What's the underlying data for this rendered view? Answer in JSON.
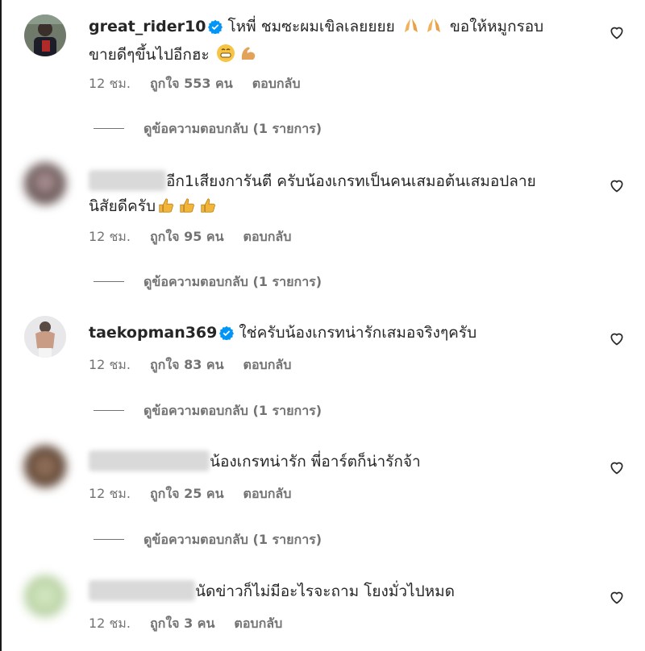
{
  "comments": [
    {
      "username": "great_rider10",
      "verified": true,
      "text": "โหพี่ ชมซะผมเขิลเลยยยย 🙏🙏 ขอให้หมูกรอบขายดีๆขึ้นไปอีกฮะ 😁💪",
      "text_line1": "โหพี่ ชมซะผมเขิลเลยยยย",
      "text_line1b": "ขอให้หมูกรอบ",
      "text_line2": "ขายดีๆขึ้นไปอีกฮะ",
      "time": "12 ชม.",
      "likes": "ถูกใจ 553 คน",
      "reply": "ตอบกลับ",
      "view_replies": "ดูข้อความตอบกลับ (1 รายการ)"
    },
    {
      "username": "",
      "verified": false,
      "text_line1": "อีก1เสียงการันตี ครับน้องเกรทเป็นคนเสมอต้นเสมอปลาย",
      "text_line2": "นิสัยดีครับ",
      "time": "12 ชม.",
      "likes": "ถูกใจ 95 คน",
      "reply": "ตอบกลับ",
      "view_replies": "ดูข้อความตอบกลับ (1 รายการ)"
    },
    {
      "username": "taekopman369",
      "verified": true,
      "text_line1": "ใช่ครับน้องเกรทน่ารักเสมอจริงๆครับ",
      "time": "12 ชม.",
      "likes": "ถูกใจ 83 คน",
      "reply": "ตอบกลับ",
      "view_replies": "ดูข้อความตอบกลับ (1 รายการ)"
    },
    {
      "username": "",
      "verified": false,
      "text_line1": "น้องเกรทน่ารัก พี่อาร์ตก็น่ารักจ้า",
      "time": "12 ชม.",
      "likes": "ถูกใจ 25 คน",
      "reply": "ตอบกลับ",
      "view_replies": "ดูข้อความตอบกลับ (1 รายการ)"
    },
    {
      "username": "",
      "verified": false,
      "text_line1": "นัดข่าวก็ไม่มีอะไรจะถาม โยงมั่วไปหมด",
      "time": "12 ชม.",
      "likes": "ถูกใจ 3 คน",
      "reply": "ตอบกลับ"
    }
  ],
  "icons": {
    "heart": "heart-outline-icon",
    "verified": "verified-badge-icon",
    "pray": "folded-hands-emoji",
    "grin": "grinning-emoji",
    "muscle": "flexed-biceps-emoji",
    "thumbs": "thumbs-up-emoji"
  },
  "colors": {
    "text": "#262626",
    "secondary": "#737373",
    "verified": "#0095f6"
  }
}
